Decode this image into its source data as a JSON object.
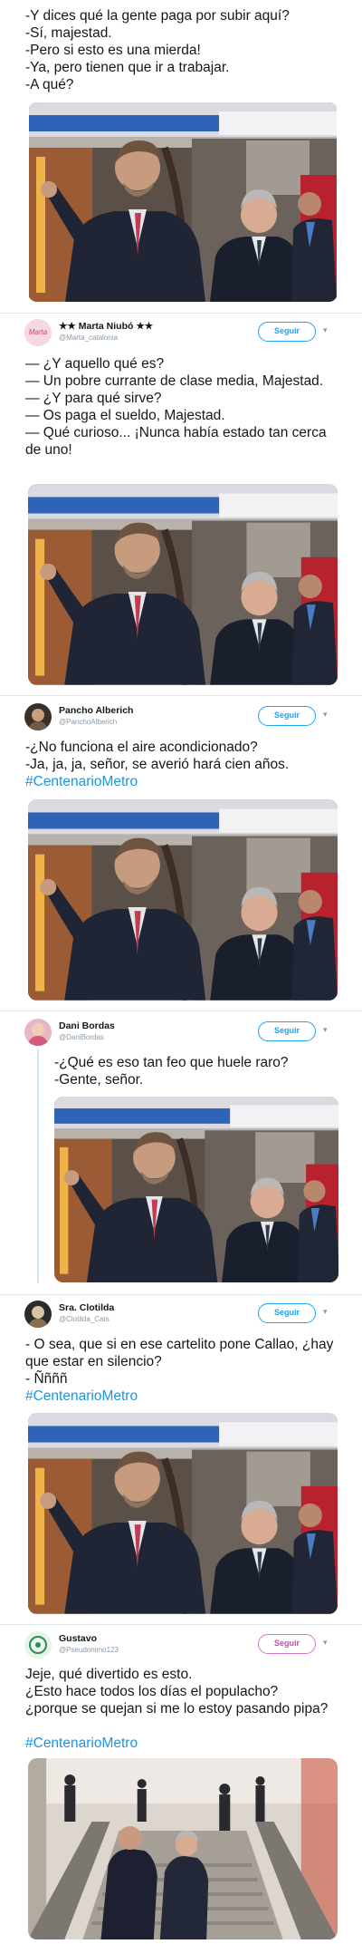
{
  "tweets": [
    {
      "text": "-Y dices qué la gente paga por subir aquí?\n-Sí, majestad.\n-Pero si esto es una mierda!\n-Ya, pero tienen que ir a trabajar.\n-A qué?"
    },
    {
      "name": "★★ Marta Niubó ★★",
      "handle": "@Marta_catalonia",
      "avatar_text": "Marta",
      "follow": "Seguir",
      "text": "— ¿Y aquello qué es?\n— Un pobre currante de clase media, Majestad.\n— ¿Y para qué sirve?\n— Os paga el sueldo, Majestad.\n— Qué curioso... ¡Nunca había estado tan cerca de uno!"
    },
    {
      "name": "Pancho Alberich",
      "handle": "@PanchoAlberich",
      "follow": "Seguir",
      "text": "-¿No funciona el aire acondicionado?\n-Ja, ja, ja, señor, se averió hará cien años.",
      "hashtag": "#CentenarioMetro"
    },
    {
      "name": "Dani Bordas",
      "handle": "@DaniBordas",
      "follow": "Seguir",
      "text": "-¿Qué es eso tan feo que huele raro?\n-Gente, señor."
    },
    {
      "name": "Sra. Clotilda",
      "handle": "@Clotilda_Cats",
      "follow": "Seguir",
      "text": "- O sea, que si en ese cartelito pone  Callao, ¿hay que estar en silencio?\n- Ññññ",
      "hashtag": "#CentenarioMetro"
    },
    {
      "name": "Gustavo",
      "handle": "@Pseudonimo123",
      "follow": "Seguir",
      "text": "Jeje, qué divertido es esto.\n¿Esto hace todos los días el populacho?\n¿porque se quejan si me lo estoy pasando pipa?",
      "hashtag": "#CentenarioMetro"
    }
  ],
  "icons": {
    "chevron": "chevron-down-icon"
  },
  "colors": {
    "link": "#1b95e0",
    "follow": "#1da1f2",
    "follow_alt": "#e0245e",
    "handle": "#8a98a5"
  }
}
